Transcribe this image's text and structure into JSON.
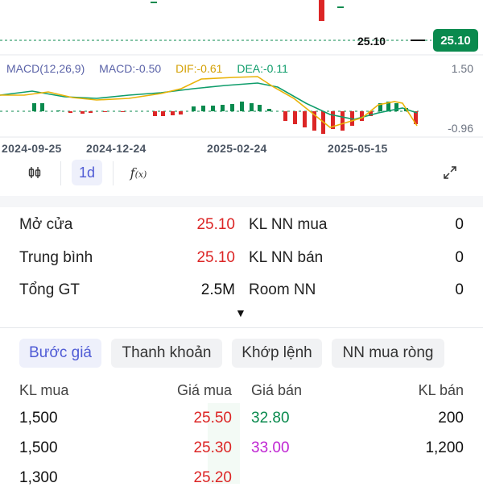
{
  "macd": {
    "label": "MACD(12,26,9)",
    "macd_label": "MACD:-0.50",
    "dif_label": "DIF:-0.61",
    "dea_label": "DEA:-0.11",
    "axis_top": "1.50",
    "axis_bottom": "-0.96"
  },
  "price": {
    "current_line_label": "25.10",
    "badge": "25.10"
  },
  "dates": [
    "2024-09-25",
    "2024-12-24",
    "2025-02-24",
    "2025-05-15"
  ],
  "toolbar": {
    "interval_label": "1d"
  },
  "stats": {
    "left": [
      {
        "label": "Mở cửa",
        "value": "25.10"
      },
      {
        "label": "Trung bình",
        "value": "25.10"
      },
      {
        "label": "Tổng GT",
        "value": "2.5M"
      }
    ],
    "right": [
      {
        "label": "KL NN mua",
        "value": "0"
      },
      {
        "label": "KL NN bán",
        "value": "0"
      },
      {
        "label": "Room NN",
        "value": "0"
      }
    ],
    "expand_glyph": "▼"
  },
  "tabs": [
    "Bước giá",
    "Thanh khoản",
    "Khớp lệnh",
    "NN mua ròng"
  ],
  "orderbook": {
    "headers": {
      "buy_vol": "KL mua",
      "buy_price": "Giá mua",
      "sell_price": "Giá bán",
      "sell_vol": "KL bán"
    },
    "rows": [
      {
        "buy_vol": "1,500",
        "buy_price": "25.50",
        "sell_price": "32.80",
        "sell_vol": "200"
      },
      {
        "buy_vol": "1,500",
        "buy_price": "25.30",
        "sell_price": "33.00",
        "sell_vol": "1,200"
      },
      {
        "buy_vol": "1,300",
        "buy_price": "25.20",
        "sell_price": "",
        "sell_vol": ""
      }
    ]
  },
  "colors": {
    "up": "#0a8a4e",
    "down": "#dc2626",
    "ceiling": "#c026d3",
    "dif_line": "#eab308",
    "dea_line": "#0f9d6b",
    "accent": "#4f5bd5"
  },
  "icons": [
    "candlestick-icon",
    "function-icon",
    "expand-icon"
  ]
}
